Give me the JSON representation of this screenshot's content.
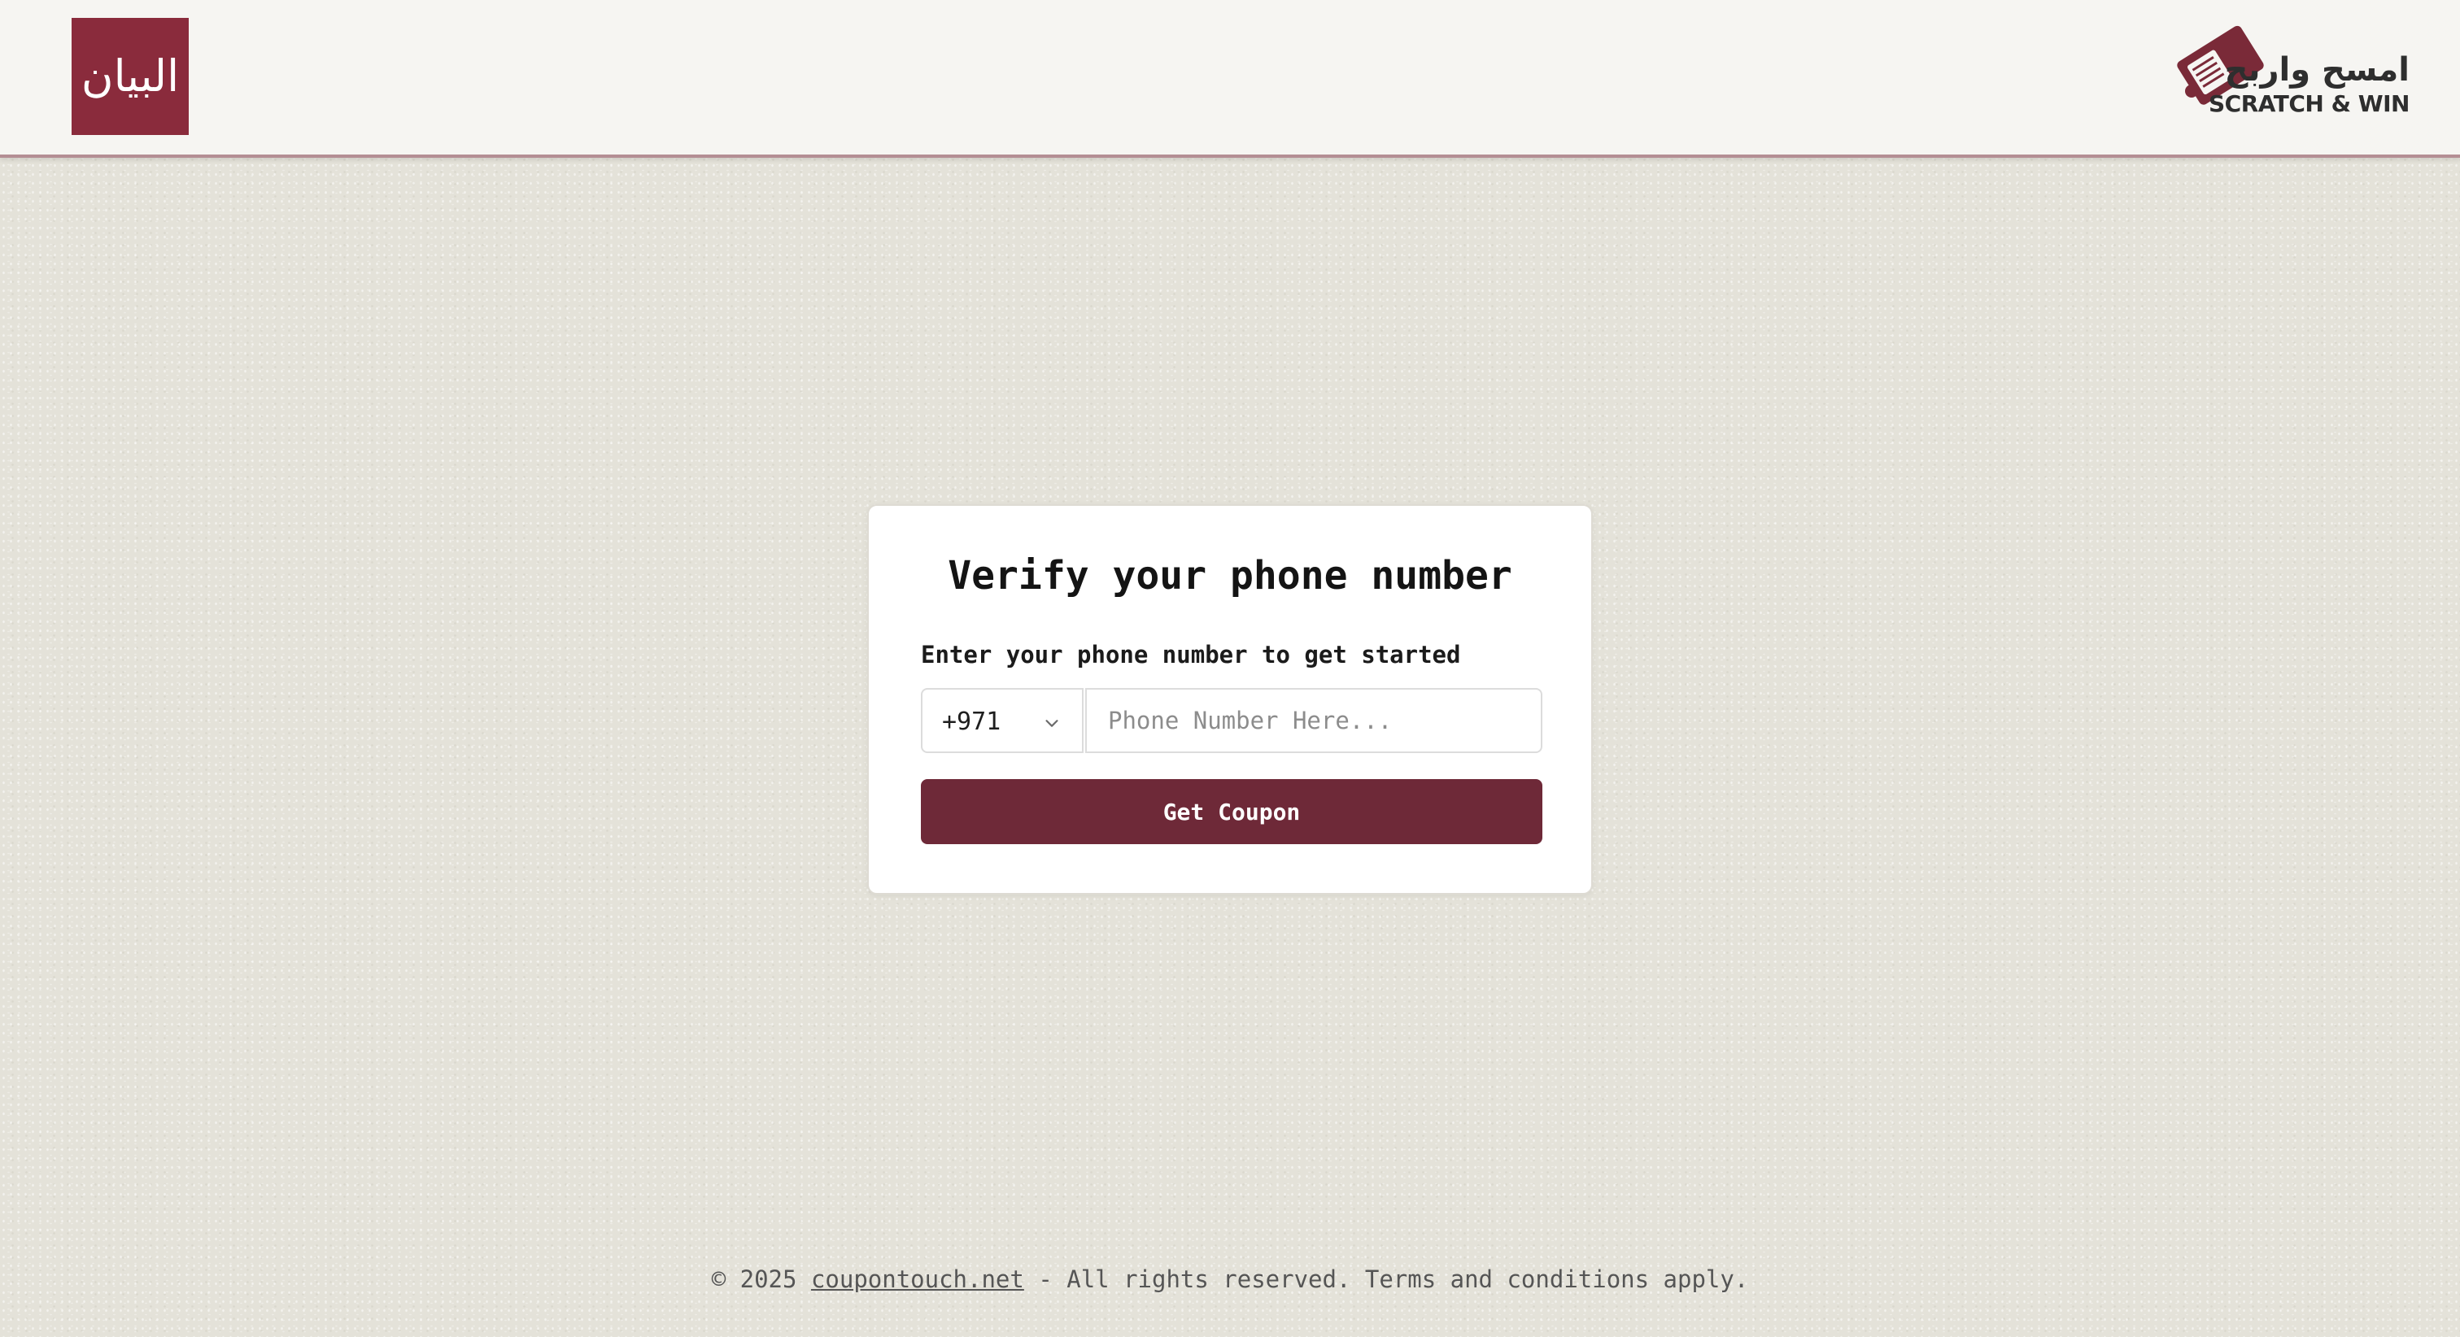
{
  "header": {
    "brand_logo_text": "البيان",
    "scratch_logo": {
      "arabic_text": "امسح واربح",
      "english_text": "SCRATCH & WIN"
    }
  },
  "card": {
    "title": "Verify your phone number",
    "label": "Enter your phone number to get started",
    "country_code": "+971",
    "phone_placeholder": "Phone Number Here...",
    "phone_value": "",
    "submit_label": "Get Coupon"
  },
  "footer": {
    "copyright": "© 2025",
    "link_text": "coupontouch.net",
    "rest": "- All rights reserved. Terms and conditions apply."
  },
  "colors": {
    "brand": "#8a2b3c",
    "button": "#6e2938",
    "page_background": "#e4e2d9"
  },
  "icons": {
    "dropdown": "chevron-down-icon",
    "scratch_card": "scratch-card-icon"
  }
}
